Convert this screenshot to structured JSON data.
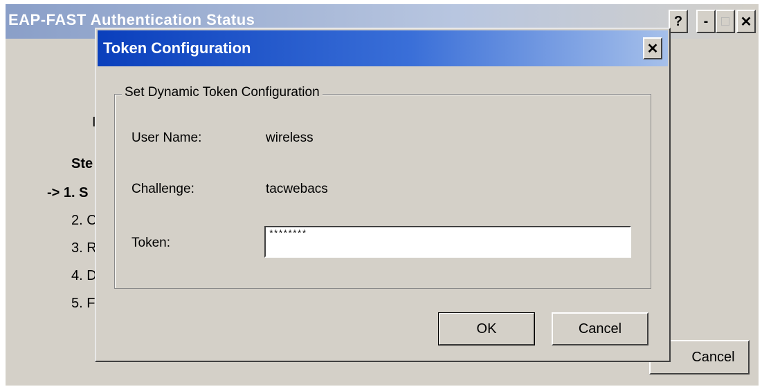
{
  "background_window": {
    "title": "EAP-FAST Authentication Status",
    "buttons": {
      "help": "?",
      "minimize": "-",
      "maximize": "□",
      "close": "✕"
    },
    "info_letter": "I",
    "steps_heading": "Ste",
    "steps": [
      "-> 1. S",
      "2. C",
      "3. R",
      "4. D",
      "5. F"
    ],
    "cancel_label": "Cancel"
  },
  "dialog": {
    "title": "Token Configuration",
    "close_glyph": "✕",
    "group_title": "Set Dynamic Token Configuration",
    "username_label": "User Name:",
    "username_value": "wireless",
    "challenge_label": "Challenge:",
    "challenge_value": "tacwebacs",
    "token_label": "Token:",
    "token_value": "********",
    "ok_label": "OK",
    "cancel_label": "Cancel"
  }
}
